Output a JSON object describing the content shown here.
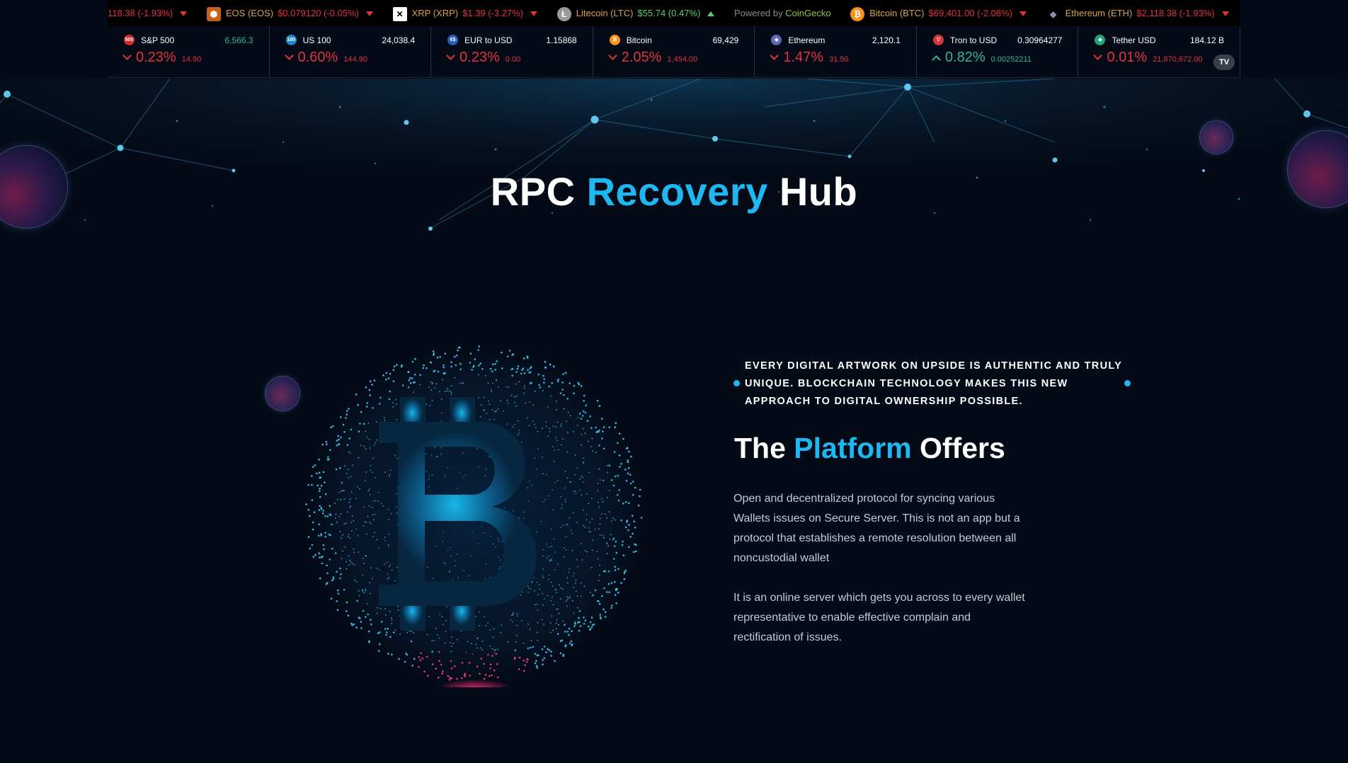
{
  "marquee": {
    "items": [
      {
        "name": "",
        "price": "118.38 (-1.93%)",
        "icon": "",
        "dir": "down",
        "color": "#e2333d"
      },
      {
        "name": "EOS (EOS)",
        "price": "$0.079120 (-0.05%)",
        "icon": "eos-icon",
        "dir": "down",
        "color": "#e2333d"
      },
      {
        "name": "XRP (XRP)",
        "price": "$1.39 (-3.27%)",
        "icon": "xrp-icon",
        "dir": "down",
        "color": "#e2333d"
      },
      {
        "name": "Litecoin (LTC)",
        "price": "$55.74 (0.47%)",
        "icon": "litecoin-icon",
        "dir": "up",
        "color": "#56d06a"
      },
      {
        "name": "Bitcoin (BTC)",
        "price": "$69,401.00 (-2.08%)",
        "icon": "bitcoin-icon",
        "dir": "down",
        "color": "#e2333d"
      },
      {
        "name": "Ethereum (ETH)",
        "price": "$2,118.38 (-1.93%)",
        "icon": "ethereum-icon",
        "dir": "down",
        "color": "#e2333d"
      }
    ],
    "powered_prefix": "Powered by",
    "powered_brand": "CoinGecko"
  },
  "ticker": [
    {
      "name": "S&P 500",
      "value": "6,566.3",
      "change": "0.23%",
      "abs": "14.90",
      "dir": "down",
      "logo": "500",
      "logo_color": "#d62a2a",
      "value_color": "#2fb898"
    },
    {
      "name": "US 100",
      "value": "24,038.4",
      "change": "0.60%",
      "abs": "144.90",
      "dir": "down",
      "logo": "100",
      "logo_color": "#1e88c8",
      "value_color": "#ffffff"
    },
    {
      "name": "EUR to USD",
      "value": "1.15868",
      "change": "0.23%",
      "abs": "0.00",
      "dir": "down",
      "logo": "€$",
      "logo_color": "#2b5fbf",
      "value_color": "#ffffff"
    },
    {
      "name": "Bitcoin",
      "value": "69,429",
      "change": "2.05%",
      "abs": "1,454.00",
      "dir": "down",
      "logo": "₿",
      "logo_color": "#f7931a",
      "value_color": "#ffffff"
    },
    {
      "name": "Ethereum",
      "value": "2,120.1",
      "change": "1.47%",
      "abs": "31.50",
      "dir": "down",
      "logo": "◆",
      "logo_color": "#5a6ab8",
      "value_color": "#ffffff"
    },
    {
      "name": "Tron to USD",
      "value": "0.30964277",
      "change": "0.82%",
      "abs": "0.00252211",
      "dir": "up",
      "logo": "▽",
      "logo_color": "#d8363a",
      "value_color": "#ffffff"
    },
    {
      "name": "Tether USD",
      "value": "184.12 B",
      "change": "0.01%",
      "abs": "21,870,672.00",
      "dir": "down",
      "logo": "◈",
      "logo_color": "#26a17b",
      "value_color": "#ffffff"
    }
  ],
  "ticker_badge": "TV",
  "colors": {
    "negative": "#e2333d",
    "positive": "#2fb898",
    "accent": "#1fb7ef"
  },
  "hero": {
    "title_pre": "RPC ",
    "title_accent": "Recovery",
    "title_post": " Hub"
  },
  "section": {
    "tagline": "Every digital artwork on Upside is authentic and truly unique. Blockchain technology makes this new approach to digital ownership possible.",
    "heading_pre": "The ",
    "heading_accent": "Platform",
    "heading_post": " Offers",
    "paragraph1": "Open and decentralized protocol for syncing various Wallets issues on Secure Server. This is not an app but a protocol that establishes a remote resolution between all noncustodial wallet",
    "paragraph2": "It is an online server which gets you across to every wallet representative to enable effective complain and rectification of issues."
  }
}
